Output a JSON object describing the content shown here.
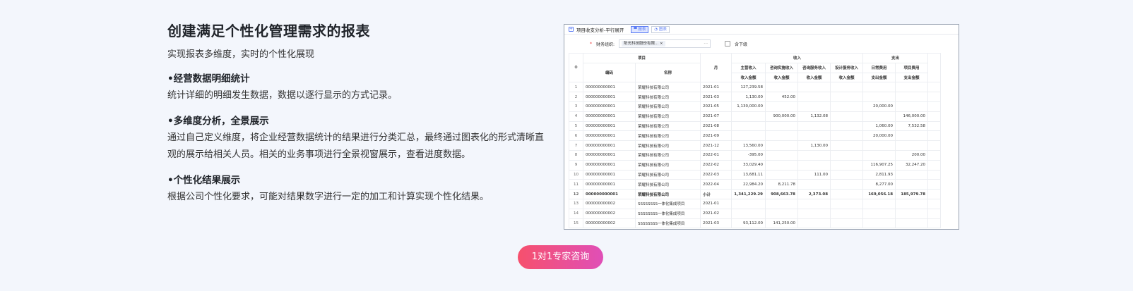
{
  "left": {
    "title": "创建满足个性化管理需求的报表",
    "subtitle": "实现报表多维度，实时的个性化展现",
    "features": [
      {
        "title": "•经营数据明细统计",
        "desc": "统计详细的明细发生数据，数据以逐行显示的方式记录。"
      },
      {
        "title": "•多维度分析，全景展示",
        "desc": "通过自己定义维度，将企业经营数据统计的结果进行分类汇总，最终通过图表化的形式清晰直观的展示给相关人员。相关的业务事项进行全景视窗展示，查看进度数据。"
      },
      {
        "title": "•个性化结果展示",
        "desc": "根据公司个性化要求，可能对结果数字进行一定的加工和计算实现个性化结果。"
      }
    ]
  },
  "screenshot": {
    "tab_title": "项目收支分析-平行展开",
    "btn_report": "报表",
    "btn_chart": "图表",
    "filter_label": "财务组织:",
    "filter_chip": "阳光科技股份有限...",
    "filter_more": "···",
    "checkbox_label": "含下级",
    "headers": {
      "group_project": "项目",
      "group_income": "收入",
      "group_expense": "支出",
      "code": "编码",
      "name": "名称",
      "month": "月",
      "c1a": "主营收入",
      "c1b": "收入金额",
      "c2a": "咨询实施收入",
      "c2b": "收入金额",
      "c3a": "咨询服务收入",
      "c3b": "收入金额",
      "c4a": "设计服务收入",
      "c4b": "收入金额",
      "c5a": "日常费用",
      "c5b": "支出金额",
      "c6a": "项目费用",
      "c6b": "支出金额"
    },
    "rows": [
      [
        "1",
        "000000000001",
        "荣耀科技有限公司",
        "2021-01",
        "127,239.58",
        "",
        "",
        "",
        "",
        ""
      ],
      [
        "2",
        "000000000001",
        "荣耀科技有限公司",
        "2021-03",
        "1,130.00",
        "452.00",
        "",
        "",
        "",
        ""
      ],
      [
        "3",
        "000000000001",
        "荣耀科技有限公司",
        "2021-05",
        "1,130,000.00",
        "",
        "",
        "",
        "20,000.00",
        ""
      ],
      [
        "4",
        "000000000001",
        "荣耀科技有限公司",
        "2021-07",
        "",
        "900,000.00",
        "1,132.08",
        "",
        "",
        "146,000.00"
      ],
      [
        "5",
        "000000000001",
        "荣耀科技有限公司",
        "2021-08",
        "",
        "",
        "",
        "",
        "1,060.00",
        "7,532.58"
      ],
      [
        "6",
        "000000000001",
        "荣耀科技有限公司",
        "2021-09",
        "",
        "",
        "",
        "",
        "20,000.00",
        ""
      ],
      [
        "7",
        "000000000001",
        "荣耀科技有限公司",
        "2021-12",
        "13,560.00",
        "",
        "1,130.00",
        "",
        "",
        ""
      ],
      [
        "8",
        "000000000001",
        "荣耀科技有限公司",
        "2022-01",
        "-395.00",
        "",
        "",
        "",
        "",
        "200.00"
      ],
      [
        "9",
        "000000000001",
        "荣耀科技有限公司",
        "2022-02",
        "33,029.40",
        "",
        "",
        "",
        "116,907.25",
        "32,247.20"
      ],
      [
        "10",
        "000000000001",
        "荣耀科技有限公司",
        "2022-03",
        "13,681.11",
        "",
        "111.00",
        "",
        "2,811.93",
        ""
      ],
      [
        "11",
        "000000000001",
        "荣耀科技有限公司",
        "2022-04",
        "22,984.20",
        "8,211.78",
        "",
        "",
        "8,277.00",
        ""
      ],
      [
        "12",
        "000000000001",
        "荣耀科技有限公司",
        "小计",
        "1,341,229.29",
        "908,663.78",
        "2,373.08",
        "",
        "169,056.18",
        "185,979.78"
      ],
      [
        "13",
        "000000000002",
        "SSSSSSSS一体化集成项目",
        "2021-01",
        "",
        "",
        "",
        "",
        "",
        ""
      ],
      [
        "14",
        "000000000002",
        "SSSSSSSS一体化集成项目",
        "2021-02",
        "",
        "",
        "",
        "",
        "",
        ""
      ],
      [
        "15",
        "000000000002",
        "SSSSSSSS一体化集成项目",
        "2021-03",
        "93,112.00",
        "141,250.00",
        "",
        "",
        "",
        ""
      ]
    ]
  },
  "cta": {
    "label": "1对1专家咨询"
  }
}
